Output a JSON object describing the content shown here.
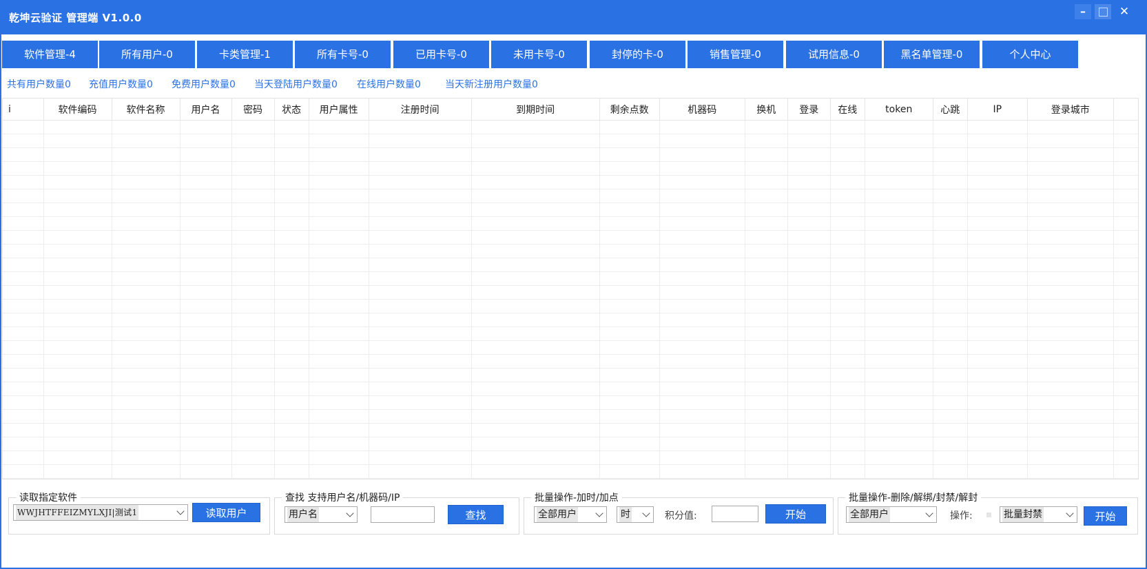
{
  "window": {
    "title": "乾坤云验证 管理端 V1.0.0",
    "minimize_label": "–",
    "close_label": "✕"
  },
  "colors": {
    "accent": "#2a71e4",
    "white": "#ffffff"
  },
  "tabs": [
    "软件管理-4",
    "所有用户-0",
    "卡类管理-1",
    "所有卡号-0",
    "已用卡号-0",
    "未用卡号-0",
    "封停的卡-0",
    "销售管理-0",
    "试用信息-0",
    "黑名单管理-0",
    "个人中心"
  ],
  "stats": [
    "共有用户数量0",
    "充值用户数量0",
    "免费用户数量0",
    "当天登陆用户数量0",
    "在线用户数量0",
    "当天新注册用户数量0"
  ],
  "table": {
    "columns": [
      "i",
      "软件编码",
      "软件名称",
      "用户名",
      "密码",
      "状态",
      "用户属性",
      "注册时间",
      "到期时间",
      "剩余点数",
      "机器码",
      "换机",
      "登录",
      "在线",
      "token",
      "心跳",
      "IP",
      "登录城市"
    ]
  },
  "read_group": {
    "legend": "读取指定软件",
    "software_select_value": "WWJHTFFEIZMYLXJI|测试1",
    "read_button": "读取用户"
  },
  "search_group": {
    "legend": "查找 支持用户名/机器码/IP",
    "field_select_value": "用户名",
    "search_button": "查找"
  },
  "batch_time_group": {
    "legend": "批量操作-加时/加点",
    "target_select_value": "全部用户",
    "unit_select_value": "时",
    "points_label": "积分值:",
    "start_button": "开始"
  },
  "batch_op_group": {
    "legend": "批量操作-删除/解绑/封禁/解封",
    "target_select_value": "全部用户",
    "op_label": "操作:",
    "op_select_value": "批量封禁",
    "start_button": "开始"
  },
  "icons": [
    "minimize-icon",
    "maximize-icon",
    "close-icon",
    "chevron-down-icon"
  ]
}
